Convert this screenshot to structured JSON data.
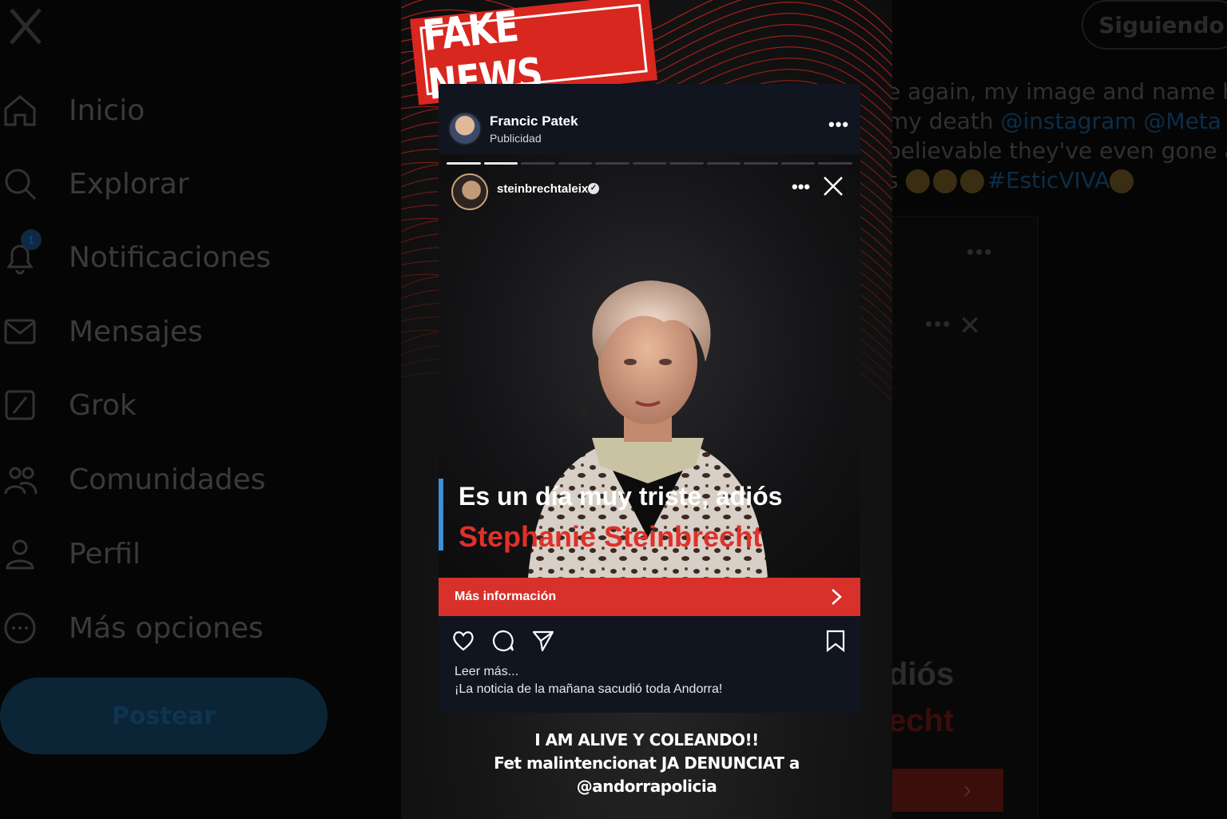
{
  "background": {
    "nav": [
      {
        "label": "Inicio",
        "icon": "home-icon"
      },
      {
        "label": "Explorar",
        "icon": "search-icon"
      },
      {
        "label": "Notificaciones",
        "icon": "bell-icon",
        "badge": "1"
      },
      {
        "label": "Mensajes",
        "icon": "mail-icon"
      },
      {
        "label": "Grok",
        "icon": "grok-icon"
      },
      {
        "label": "Comunidades",
        "icon": "communities-icon"
      },
      {
        "label": "Perfil",
        "icon": "person-icon"
      },
      {
        "label": "Más opciones",
        "icon": "more-circle-icon"
      }
    ],
    "post_button": "Postear",
    "follow_button": "Siguiendo",
    "tweet_lines": [
      "e again, my image and name have",
      " my death ",
      "believable  they've even gone as",
      "s "
    ],
    "tweet_mentions": [
      "@instagram",
      "@Meta",
      "#EsticVIVA"
    ],
    "tweet_line2_tail": " .",
    "card_dios": "diós",
    "card_ecnt": "echt"
  },
  "stamp": {
    "text": "FAKE NEWS"
  },
  "ad": {
    "author": "Francic Patek",
    "sponsored": "Publicidad",
    "story_user": "steinbrechtaleix",
    "caption_line1": "Es un día muy triste, adiós",
    "caption_line2": "Stephanie Steinbrecht",
    "cta": "Más información",
    "read_more": "Leer más...",
    "caption": "¡La noticia de la mañana sacudió toda Andorra!"
  },
  "footer": {
    "line1": "I AM ALIVE Y COLEANDO!!",
    "line2": "Fet malintencionat JA DENUNCIAT a",
    "line3": "@andorrapolicia"
  },
  "colors": {
    "accent_red": "#d8302a",
    "caption_blue": "#3e8fd6",
    "twitter_dark_blue": "#0b2436"
  }
}
